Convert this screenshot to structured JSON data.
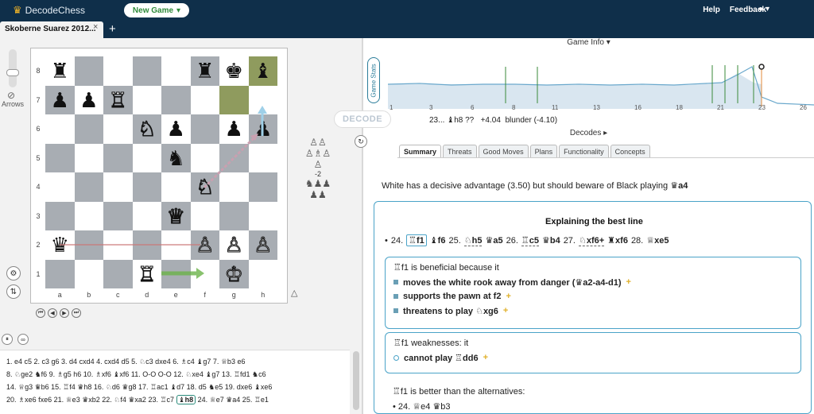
{
  "app": {
    "name": "DecodeChess",
    "new_game": "New Game",
    "help": "Help",
    "feedback": "Feedback"
  },
  "tab": {
    "title": "Skoberne Suarez 2012...",
    "close": "×",
    "add": "+"
  },
  "left": {
    "arrows_label": "Arrows",
    "decode_label": "DECODE",
    "material_diff": "-2"
  },
  "board": {
    "ranks": [
      "8",
      "7",
      "6",
      "5",
      "4",
      "3",
      "2",
      "1"
    ],
    "files": [
      "a",
      "b",
      "c",
      "d",
      "e",
      "f",
      "g",
      "h"
    ],
    "squares": [
      [
        "♜",
        "",
        "",
        "",
        "",
        "♜",
        "♚",
        "♝"
      ],
      [
        "♟",
        "♟",
        "♖",
        "",
        "",
        "",
        "",
        ""
      ],
      [
        "",
        "",
        "",
        "♘",
        "♟",
        "",
        "♟",
        "♟"
      ],
      [
        "",
        "",
        "",
        "",
        "♞",
        "",
        "",
        ""
      ],
      [
        "",
        "",
        "",
        "",
        "",
        "♘",
        "",
        ""
      ],
      [
        "",
        "",
        "",
        "",
        "♕",
        "",
        "",
        ""
      ],
      [
        "♛",
        "",
        "",
        "",
        "",
        "♙",
        "♙",
        "♙"
      ],
      [
        "",
        "",
        "",
        "♖",
        "",
        "",
        "♔",
        ""
      ]
    ]
  },
  "moves": [
    "1. e4 c5 2. c3 g6 3. d4 cxd4 4. cxd4 d5 5. ♘c3 dxe4 6. ♗c4 ♝g7 7. ♕b3 e6",
    "8. ♘ge2 ♞f6 9. ♗g5 h6 10. ♗xf6 ♝xf6 11. O-O O-O 12. ♘xe4 ♝g7 13. ♖fd1 ♞c6",
    "14. ♕g3 ♛b6 15. ♖f4 ♛h8 16. ♘d6 ♛g8 17. ♖ac1 ♝d7 18. d5 ♞e5 19. dxe6 ♝xe6",
    "20. ♗xe6 fxe6 21. ♕e3 ♛xb2 22. ♘f4 ♛xa2 23. ♖c7",
    "♝h8",
    "24. ♕e7 ♛a4 25. ♖e1"
  ],
  "right": {
    "game_info": "Game Info ▾",
    "game_stats": "Game Stats",
    "graph_ticks": [
      "1",
      "3",
      "6",
      "8",
      "11",
      "13",
      "16",
      "18",
      "21",
      "23",
      "26"
    ],
    "eval": {
      "move": "23... ♝h8 ??",
      "score": "+4.04",
      "tag": "blunder (-4.10)"
    },
    "decodes": "Decodes ▸",
    "tabs": [
      "Summary",
      "Threats",
      "Good Moves",
      "Plans",
      "Functionality",
      "Concepts"
    ],
    "summary_pre": "White has a decisive advantage (3.50) but should beware of Black playing",
    "summary_move": "♛a4",
    "explain_title": "Explaining the best line",
    "best_line": [
      {
        "t": "24."
      },
      {
        "t": "♖f1",
        "box": true
      },
      {
        "t": "♝f6"
      },
      {
        "t": "25."
      },
      {
        "t": "♘h5",
        "ul": true
      },
      {
        "t": "♛a5"
      },
      {
        "t": "26."
      },
      {
        "t": "♖c5",
        "ul": true
      },
      {
        "t": "♛b4"
      },
      {
        "t": "27."
      },
      {
        "t": "♘xf6+",
        "ul": true
      },
      {
        "t": "♜xf6"
      },
      {
        "t": "28."
      },
      {
        "t": "♕xe5"
      }
    ],
    "card1": {
      "title": "♖f1 is beneficial because it",
      "items": [
        "moves the white rook away from danger (♛a2-a4-d1)",
        "supports the pawn at f2",
        "threatens to play ♘xg6"
      ]
    },
    "card2": {
      "title": "♖f1 weaknesses: it",
      "items": [
        "cannot play ♖dd6"
      ]
    },
    "alt_title": "♖f1 is better than the alternatives:",
    "alt_line": "• 24. ♕e4 ♛b3",
    "colors": {
      "accent": "#4aa3c8",
      "navbar": "#0f2f4a",
      "green": "#2f8a3a",
      "gold": "#e0b02a"
    }
  }
}
